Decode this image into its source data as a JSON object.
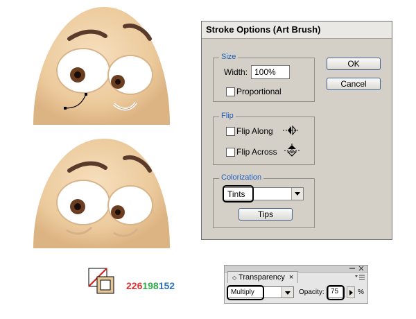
{
  "dialog": {
    "title": "Stroke Options (Art Brush)",
    "size_group": {
      "label": "Size",
      "width_label": "Width:",
      "width_value": "100%",
      "proportional_label": "Proportional"
    },
    "flip_group": {
      "label": "Flip",
      "flip_along_label": "Flip Along",
      "flip_across_label": "Flip Across"
    },
    "colorization_group": {
      "label": "Colorization",
      "method_value": "Tints",
      "tips_label": "Tips"
    },
    "ok_label": "OK",
    "cancel_label": "Cancel"
  },
  "swatch": {
    "fill_color": "#e2c698",
    "rgb": {
      "r": "226",
      "g": "198",
      "b": "152"
    },
    "rgb_colors": {
      "r": "#e03030",
      "g": "#2ea84a",
      "b": "#2a6fc0"
    }
  },
  "transparency": {
    "tab_label": "Transparency",
    "blend_mode_value": "Multiply",
    "opacity_label": "Opacity:",
    "opacity_value": "75",
    "percent_label": "%"
  },
  "colors": {
    "egg_skin": "#efd2a8",
    "link_blue": "#1c5cbf"
  },
  "icons": [
    "close-icon",
    "panel-menu-icon",
    "flip-along-icon",
    "flip-across-icon",
    "chevron-down-icon",
    "chevron-right-icon"
  ]
}
